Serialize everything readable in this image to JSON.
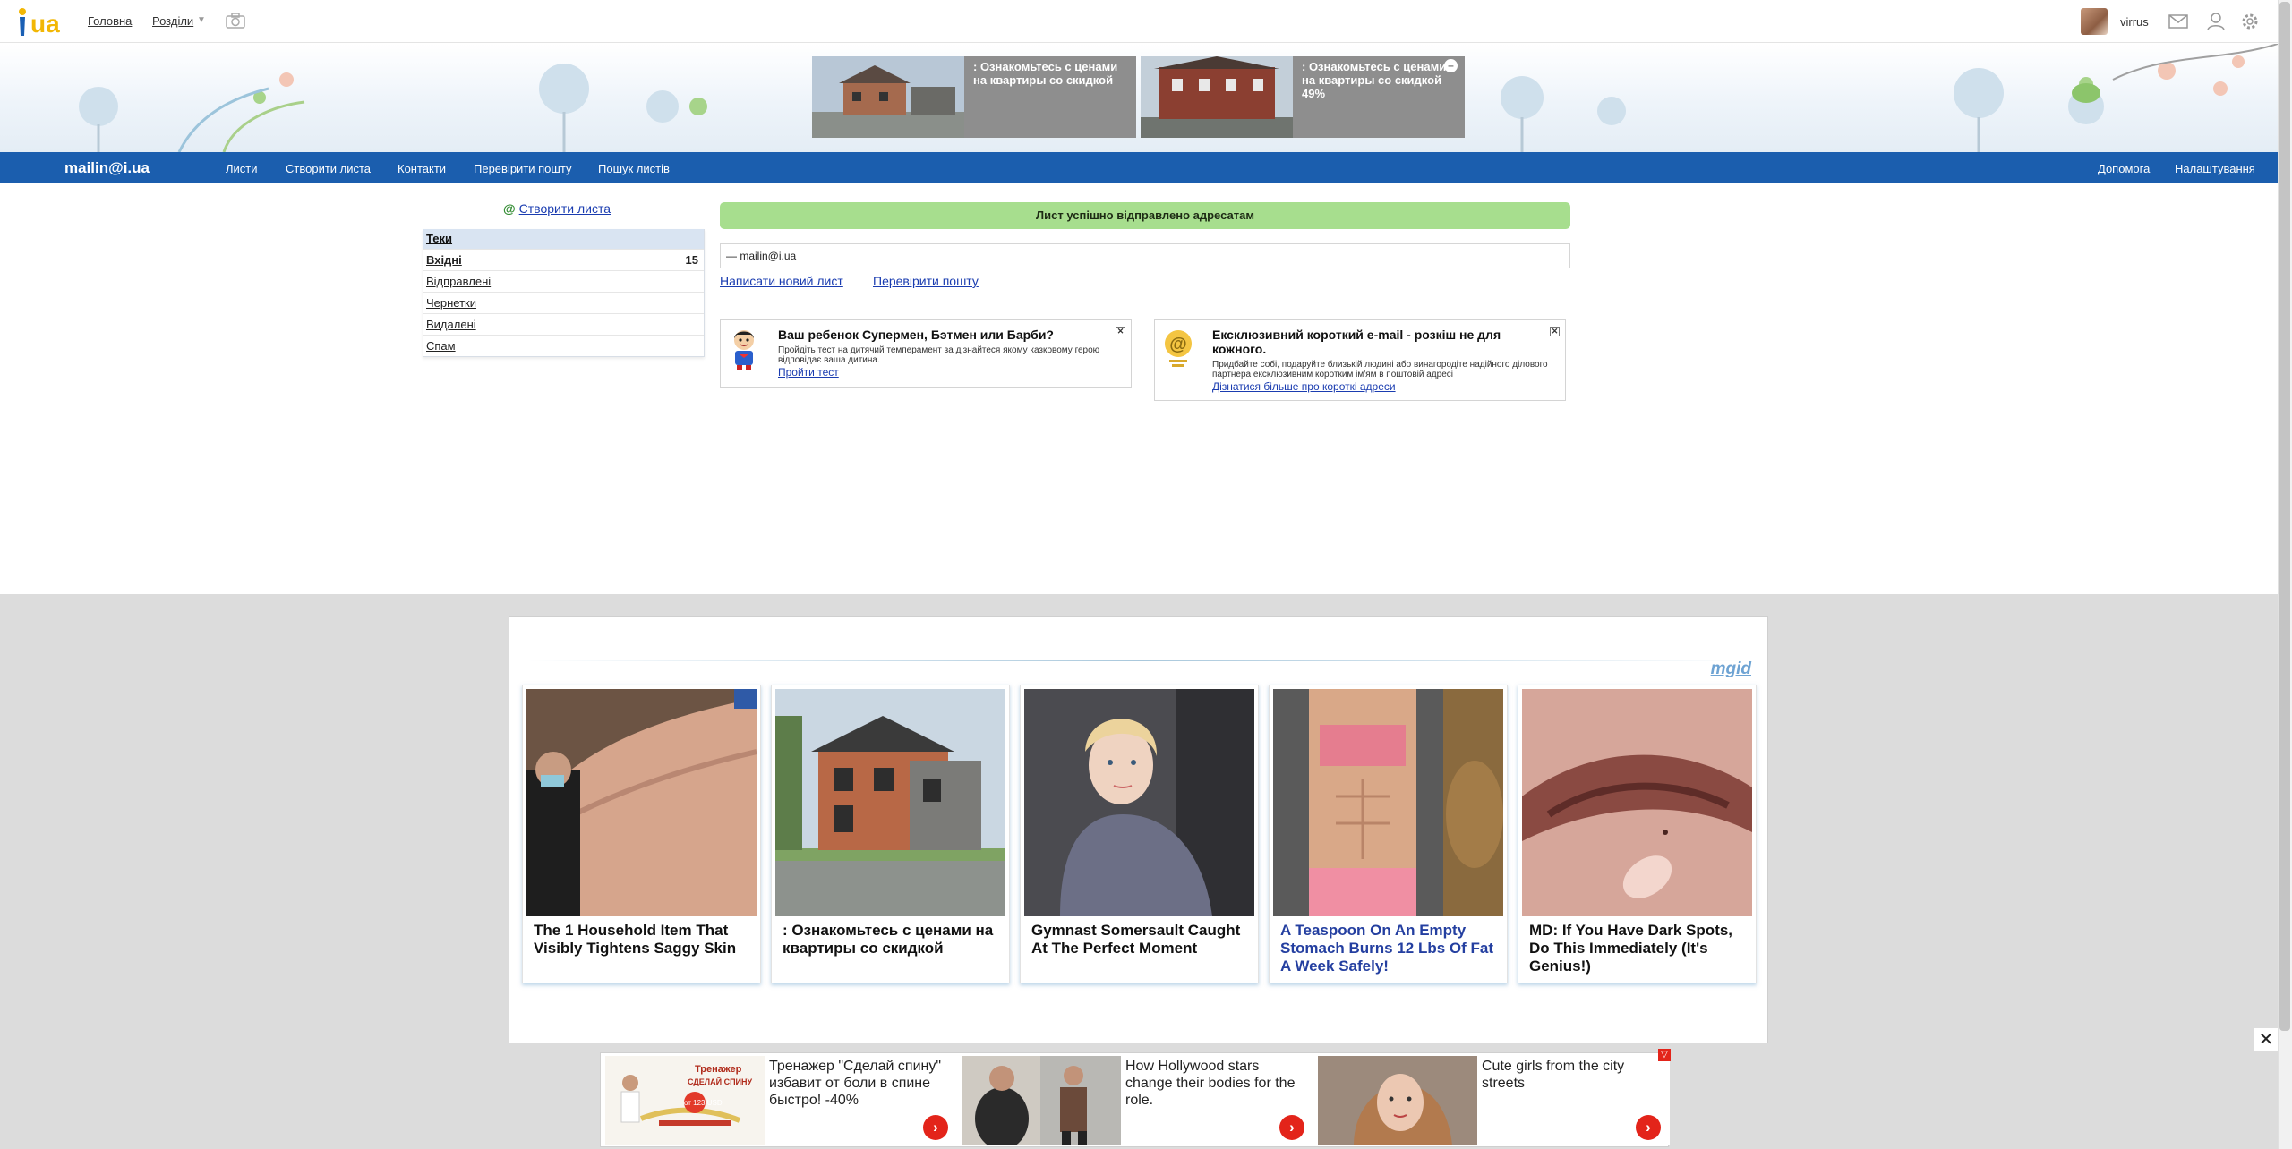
{
  "topbar": {
    "logo": "ua",
    "nav_home": "Головна",
    "nav_sections": "Розділи",
    "username": "virrus"
  },
  "header": {
    "banners": [
      {
        "text": ": Ознакомьтесь с ценами на квартиры со скидкой"
      },
      {
        "text": ": Ознакомьтесь с ценами на квартиры со скидкой 49%"
      }
    ]
  },
  "bluenav": {
    "brand": "mailin@i.ua",
    "links": [
      "Листи",
      "Створити листа",
      "Контакти",
      "Перевірити пошту",
      "Пошук листів"
    ],
    "help": "Допомога",
    "settings": "Налаштування"
  },
  "sidebar": {
    "create_link": "Створити листа",
    "folders_title": "Теки",
    "folders": [
      {
        "label": "Вхідні",
        "count": "15"
      },
      {
        "label": "Відправлені"
      },
      {
        "label": "Чернетки"
      },
      {
        "label": "Видалені"
      },
      {
        "label": "Спам"
      }
    ]
  },
  "main": {
    "success_message": "Лист успішно відправлено адресатам",
    "recipient": "— mailin@i.ua",
    "new_letter": "Написати новий лист",
    "check_mail": "Перевірити пошту",
    "promo_1": {
      "title": "Ваш ребенок Супермен, Бэтмен или Барби?",
      "text": "Пройдіть тест на дитячий темперамент за дізнайтеся якому казковому герою відповідає ваша дитина.",
      "link": "Пройти тест"
    },
    "promo_2": {
      "title": "Ексклюзивний короткий e-mail - розкіш не для кожного.",
      "text": "Придбайте собі, подаруйте близькій людині або винагородіте надійного ділового партнера ексклюзивним коротким ім'ям в поштовій адресі",
      "link": "Дізнатися більше про короткі адреси"
    }
  },
  "ads": {
    "brand": "mgid",
    "cards": [
      {
        "title": "The 1 Household Item That Visibly Tightens Saggy Skin"
      },
      {
        "title": ": Ознакомьтесь с ценами на квартиры со скидкой"
      },
      {
        "title": "Gymnast Somersault Caught At The Perfect Moment"
      },
      {
        "title": "A Teaspoon On An Empty Stomach Burns 12 Lbs Of Fat A Week Safely!"
      },
      {
        "title": "MD: If You Have Dark Spots, Do This Immediately (It's Genius!)"
      }
    ]
  },
  "bottom_ads": {
    "cards": [
      {
        "text": "Тренажер \"Сделай спину\" избавит от боли в спине быстро! -40%",
        "image_text_1": "Тренажер",
        "image_text_2": "СДЕЛАЙ СПИНУ",
        "image_text_3": "от 123 USD"
      },
      {
        "text": "How Hollywood stars change their bodies for the role."
      },
      {
        "text": "Cute girls from the city streets"
      }
    ]
  }
}
